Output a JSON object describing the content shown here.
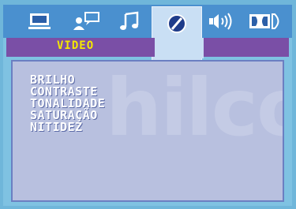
{
  "tabs": [
    {
      "icon": "monitor-icon"
    },
    {
      "icon": "user-chat-icon"
    },
    {
      "icon": "music-note-icon"
    },
    {
      "icon": "picture-settings-icon",
      "active": true
    },
    {
      "icon": "speaker-icon"
    },
    {
      "icon": "dolby-icon"
    }
  ],
  "header": {
    "title": "VIDEO"
  },
  "watermark": {
    "text": "hilco"
  },
  "menu": {
    "items": [
      "BRILHO",
      "CONTRASTE",
      "TONALIDADE",
      "SATURAÇÃO",
      "NITIDEZ"
    ]
  },
  "colors": {
    "background": "#6fb6da",
    "topbar": "#4a90cf",
    "header_band": "#7a4fa6",
    "title": "#f5e800",
    "active_indicator": "#f5c400",
    "panel": "#b8c0df",
    "menu_text": "#ffffff"
  }
}
